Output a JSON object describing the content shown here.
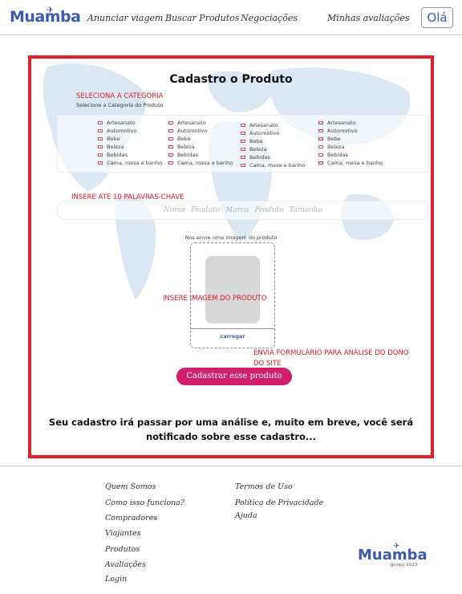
{
  "header": {
    "logo": "Muamba",
    "nav": [
      "Anunciar viagem",
      "Buscar Produtos",
      "Negociações",
      "Minhas avaliações"
    ],
    "ola": "Olá"
  },
  "form": {
    "title": "Cadastro o Produto",
    "note_category": "SELECIONA A CATEGORIA",
    "category_subtitle": "Selecione a Categoria do Produto",
    "category_columns": [
      [
        "Artesanato",
        "Automotivo",
        "Bebe",
        "Beleza",
        "Bebidas",
        "Cama, mesa e banho"
      ],
      [
        "Artesanato",
        "Automotivo",
        "Bebe",
        "Beleza",
        "Bebidas",
        "Cama, mesa e banho"
      ],
      [
        "Artesanato",
        "Automotivo",
        "Bebe",
        "Beleza",
        "Bebidas",
        "Cama, mesa e banho"
      ],
      [
        "Artesanato",
        "Automotivo",
        "Bebe",
        "Beleza",
        "Bebidas",
        "Cama, mesa e banho"
      ]
    ],
    "note_keywords": "INSERE ATÉ 10 PALAVRAS-CHAVE",
    "keywords_placeholder": "Nome Produto Marca Produto Tamanho",
    "upload_label": "Nos envie uma imagem do produto",
    "note_image": "INSERE IMAGEM DO PRODUTO",
    "upload_button": "carregar",
    "note_submit_line1": "ENVIA FORMULÁRIO PARA ANÁLISE DO DONO",
    "note_submit_line2": "DO SITE",
    "submit_button": "Cadastrar esse produto",
    "notice": "Seu cadastro irá passar por uma análise e, muito em breve, você será notificado sobre esse cadastro..."
  },
  "footer": {
    "col1": [
      "Quem Somos",
      "Como isso funciona?",
      "Compradores",
      "Viajantes",
      "Produtos",
      "Avaliações",
      "Login"
    ],
    "col2": [
      "Termos de Uso",
      "Política de Privacidade",
      "Ajuda"
    ],
    "logo": "Muamba",
    "copyright": "@copy 2023"
  },
  "colors": {
    "brand": "#3f5aa8",
    "annotation": "#d7202a",
    "button": "#d1206b"
  }
}
